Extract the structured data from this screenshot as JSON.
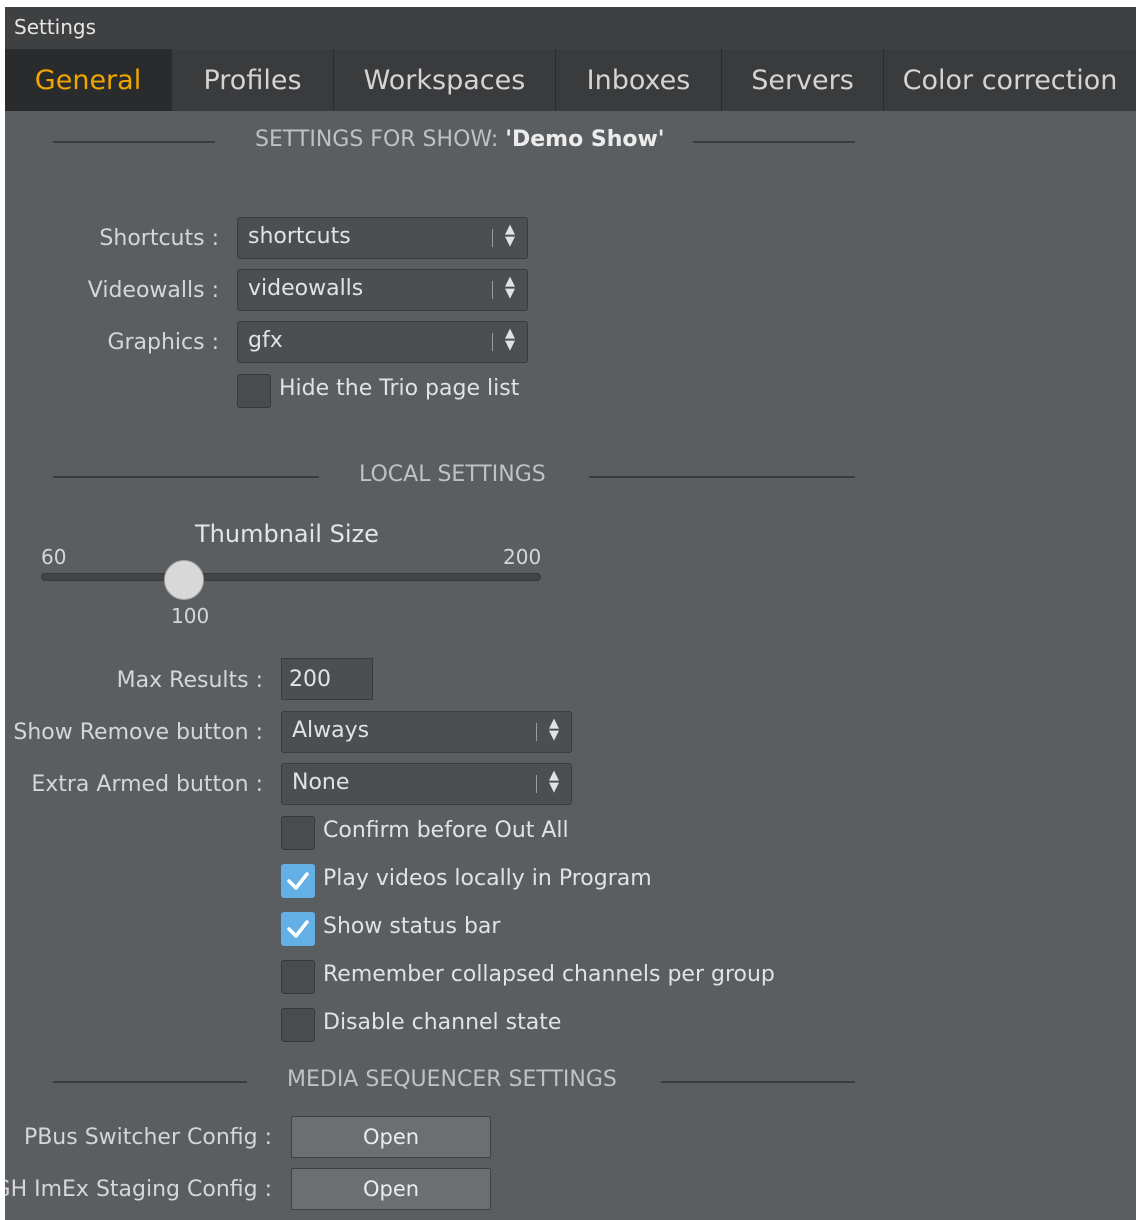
{
  "window": {
    "title": "Settings"
  },
  "tabs": [
    {
      "label": "General",
      "active": true
    },
    {
      "label": "Profiles",
      "active": false
    },
    {
      "label": "Workspaces",
      "active": false
    },
    {
      "label": "Inboxes",
      "active": false
    },
    {
      "label": "Servers",
      "active": false
    },
    {
      "label": "Color correction",
      "active": false
    }
  ],
  "show_settings": {
    "header_prefix": "SETTINGS FOR SHOW: ",
    "show_name": "'Demo Show'",
    "shortcuts": {
      "label": "Shortcuts :",
      "value": "shortcuts"
    },
    "videowalls": {
      "label": "Videowalls :",
      "value": "videowalls"
    },
    "graphics": {
      "label": "Graphics :",
      "value": "gfx"
    },
    "hide_trio": {
      "label": "Hide the Trio page list",
      "checked": false
    }
  },
  "local_settings": {
    "header": "LOCAL SETTINGS",
    "thumbnail": {
      "title": "Thumbnail Size",
      "min": "60",
      "max": "200",
      "value": "100"
    },
    "max_results": {
      "label": "Max Results :",
      "value": "200"
    },
    "show_remove": {
      "label": "Show Remove button :",
      "value": "Always"
    },
    "extra_armed": {
      "label": "Extra Armed button :",
      "value": "None"
    },
    "checkboxes": [
      {
        "label": "Confirm before Out All",
        "checked": false
      },
      {
        "label": "Play videos locally in Program",
        "checked": true
      },
      {
        "label": "Show status bar",
        "checked": true
      },
      {
        "label": "Remember collapsed channels per group",
        "checked": false
      },
      {
        "label": "Disable channel state",
        "checked": false
      }
    ]
  },
  "media_sequencer": {
    "header": "MEDIA SEQUENCER SETTINGS",
    "pbus": {
      "label": "PBus Switcher Config :",
      "button": "Open"
    },
    "gh_imex": {
      "label": "GH ImEx Staging Config :",
      "button": "Open"
    }
  },
  "colors": {
    "accent": "#f0a500",
    "checkbox_checked": "#63b0e6",
    "panel_bg": "#5b5e61"
  },
  "icons": {
    "checkmark": "checkmark-icon",
    "select_arrows": "updown-arrows-icon"
  }
}
